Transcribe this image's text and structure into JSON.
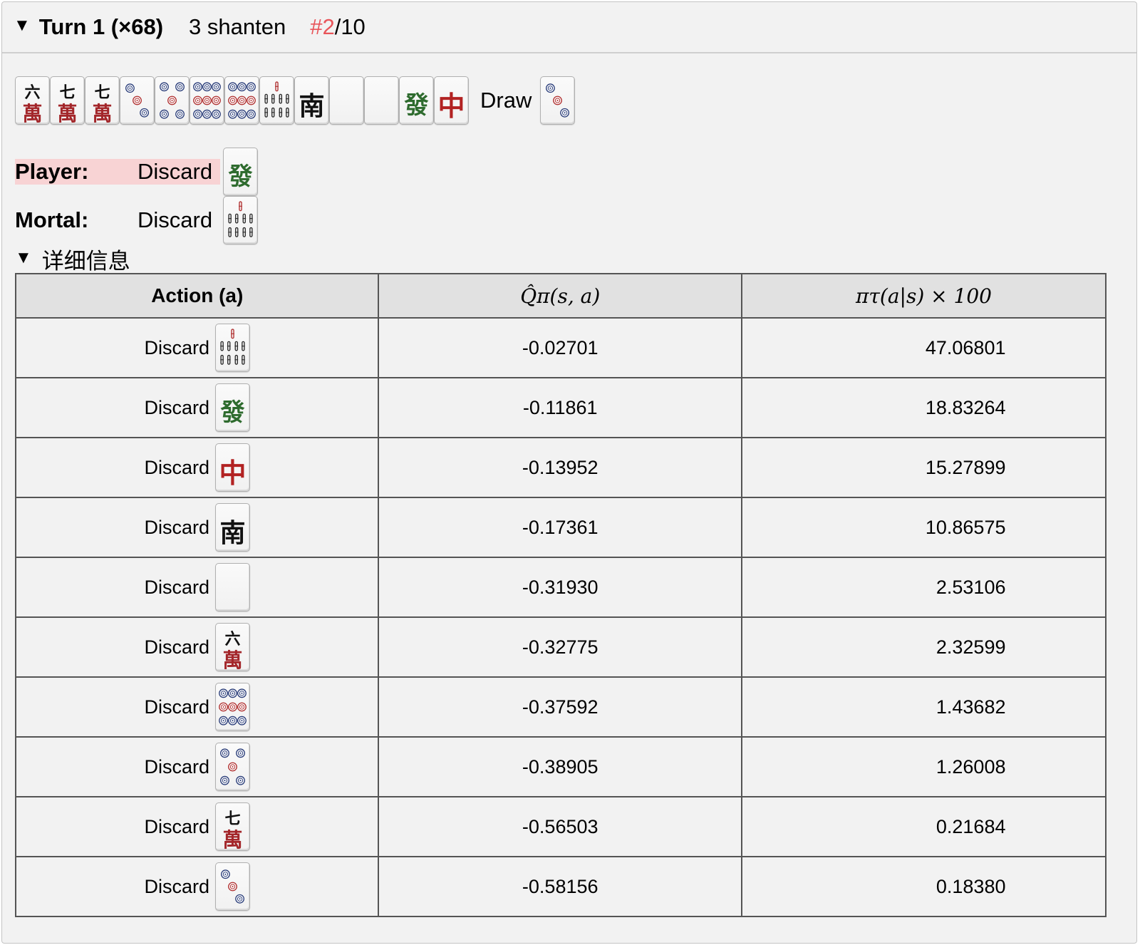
{
  "summary": {
    "turn": "Turn 1 (×68)",
    "shanten": "3 shanten",
    "rank_num": "#2",
    "rank_total": "/10"
  },
  "hand": {
    "tiles": [
      "6m",
      "7m",
      "7m",
      "3p",
      "5p",
      "9p",
      "9p",
      "8s",
      "S",
      "P",
      "P",
      "F",
      "C"
    ],
    "draw_label": "Draw",
    "draw_tile": "3p"
  },
  "player": {
    "label": "Player:",
    "verb": "Discard",
    "tile": "F"
  },
  "mortal": {
    "label": "Mortal:",
    "verb": "Discard",
    "tile": "8s"
  },
  "details": {
    "summary": "详细信息"
  },
  "table": {
    "headers": [
      "Action (a)",
      "Q̂π(s, a)",
      "πτ(a|s) × 100"
    ],
    "rows": [
      {
        "verb": "Discard",
        "tile": "8s",
        "q": "-0.02701",
        "p": "47.06801"
      },
      {
        "verb": "Discard",
        "tile": "F",
        "q": "-0.11861",
        "p": "18.83264"
      },
      {
        "verb": "Discard",
        "tile": "C",
        "q": "-0.13952",
        "p": "15.27899"
      },
      {
        "verb": "Discard",
        "tile": "S",
        "q": "-0.17361",
        "p": "10.86575"
      },
      {
        "verb": "Discard",
        "tile": "P",
        "q": "-0.31930",
        "p": "2.53106"
      },
      {
        "verb": "Discard",
        "tile": "6m",
        "q": "-0.32775",
        "p": "2.32599"
      },
      {
        "verb": "Discard",
        "tile": "9p",
        "q": "-0.37592",
        "p": "1.43682"
      },
      {
        "verb": "Discard",
        "tile": "5p",
        "q": "-0.38905",
        "p": "1.26008"
      },
      {
        "verb": "Discard",
        "tile": "7m",
        "q": "-0.56503",
        "p": "0.21684"
      },
      {
        "verb": "Discard",
        "tile": "3p",
        "q": "-0.58156",
        "p": "0.18380"
      }
    ]
  },
  "colors": {
    "rank_accent": "#e8555a",
    "player_highlight": "#f8d3d4",
    "man_red": "#a3262a",
    "green_dragon": "#2e6b2e",
    "red_dragon": "#b22222"
  }
}
